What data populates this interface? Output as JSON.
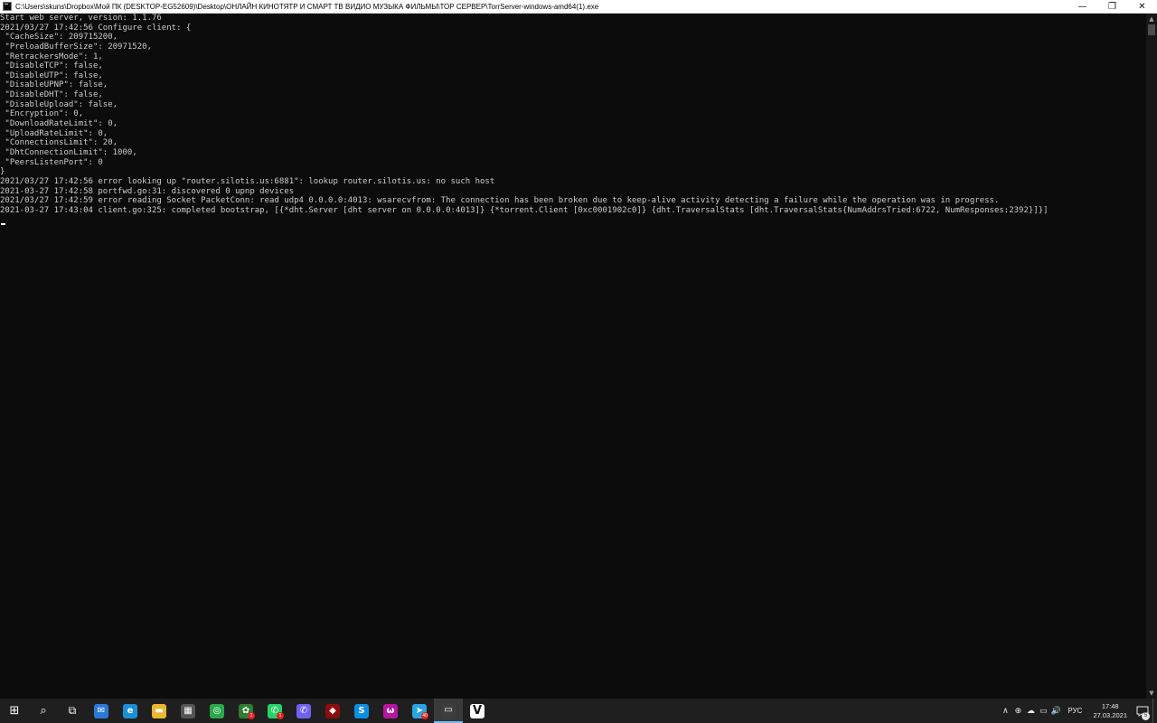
{
  "window": {
    "title": "C:\\Users\\skuns\\Dropbox\\Мой ПК (DESKTOP-EG52609)\\Desktop\\ОНЛАЙН  КИНОТЯТР  И СМАРТ ТВ  ВИДИО МУЗЫКА  ФИЛЬМЫ\\ТОР СЕРВЕР\\TorrServer-windows-amd64(1).exe",
    "controls": {
      "minimize": "—",
      "maximize": "❐",
      "close": "✕"
    }
  },
  "console": {
    "lines": [
      "Start web server, version: 1.1.76",
      "2021/03/27 17:42:56 Configure client: {",
      " \"CacheSize\": 209715200,",
      " \"PreloadBufferSize\": 20971520,",
      " \"RetrackersMode\": 1,",
      " \"DisableTCP\": false,",
      " \"DisableUTP\": false,",
      " \"DisableUPNP\": false,",
      " \"DisableDHT\": false,",
      " \"DisableUpload\": false,",
      " \"Encryption\": 0,",
      " \"DownloadRateLimit\": 0,",
      " \"UploadRateLimit\": 0,",
      " \"ConnectionsLimit\": 20,",
      " \"DhtConnectionLimit\": 1000,",
      " \"PeersListenPort\": 0",
      "}",
      "2021/03/27 17:42:56 error looking up \"router.silotis.us:6881\": lookup router.silotis.us: no such host",
      "2021-03-27 17:42:58 portfwd.go:31: discovered 0 upnp devices",
      "2021/03/27 17:42:59 error reading Socket PacketConn: read udp4 0.0.0.0:4013: wsarecvfrom: The connection has been broken due to keep-alive activity detecting a failure while the operation was in progress.",
      "2021-03-27 17:43:04 client.go:325: completed bootstrap, [{*dht.Server [dht server on 0.0.0.0:4013]} {*torrent.Client [0xc0001902c0]} {dht.TraversalStats [dht.TraversalStats{NumAddrsTried:6722, NumResponses:2392}]}]"
    ]
  },
  "scrollbar": {
    "up": "▲",
    "down": "▼"
  },
  "taskbar": {
    "start": "⊞",
    "search": "⌕",
    "taskview": "⧉",
    "apps": [
      {
        "name": "mail-icon",
        "glyph": "✉",
        "color": "#2b79d6",
        "badge": ""
      },
      {
        "name": "edge-icon",
        "glyph": "e",
        "color": "#1a8fd8",
        "badge": ""
      },
      {
        "name": "file-explorer-icon",
        "glyph": "▬",
        "color": "#e8b833",
        "badge": ""
      },
      {
        "name": "store-icon",
        "glyph": "▦",
        "color": "#555555",
        "badge": ""
      },
      {
        "name": "search-app-icon",
        "glyph": "◎",
        "color": "#2ba84a",
        "badge": ""
      },
      {
        "name": "paw-app-icon",
        "glyph": "✿",
        "color": "#2e7d32",
        "badge": "1"
      },
      {
        "name": "whatsapp-icon",
        "glyph": "✆",
        "color": "#25d366",
        "badge": "1"
      },
      {
        "name": "viber-icon",
        "glyph": "✆",
        "color": "#7360f2",
        "badge": ""
      },
      {
        "name": "red-app-icon",
        "glyph": "◆",
        "color": "#8b0d0d",
        "badge": ""
      },
      {
        "name": "skype-icon",
        "glyph": "S",
        "color": "#0a8fe0",
        "badge": ""
      },
      {
        "name": "purple-app-icon",
        "glyph": "ω",
        "color": "#b5179e",
        "badge": ""
      },
      {
        "name": "telegram-icon",
        "glyph": "➤",
        "color": "#2aa3df",
        "badge": "40"
      },
      {
        "name": "console-app-icon",
        "glyph": "▭",
        "color": "#3d3d3d",
        "badge": "",
        "active": true
      },
      {
        "name": "v-app-icon",
        "glyph": "V",
        "color": "#1f1f1f",
        "badge": ""
      }
    ],
    "tray": {
      "chevron": "∧",
      "icons": [
        "⊕",
        "☁",
        "▭",
        "🔊"
      ],
      "language": "РУС",
      "time": "17:48",
      "date": "27.03.2021",
      "notification_count": "5"
    }
  }
}
